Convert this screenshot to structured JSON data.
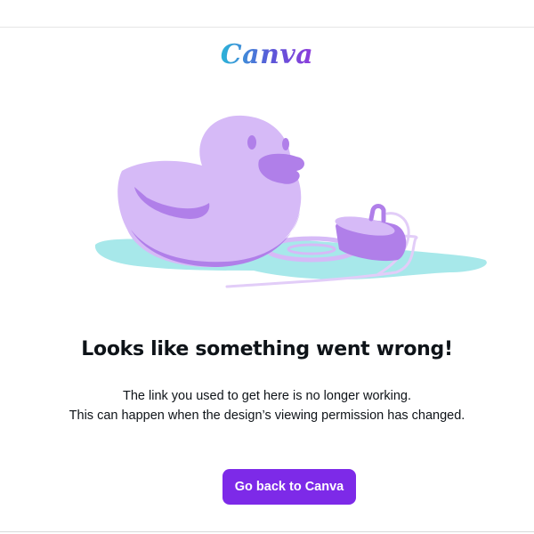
{
  "brand": {
    "name": "Canva"
  },
  "error": {
    "title": "Looks like something went wrong!",
    "description_line1": "The link you used to get here is no longer working.",
    "description_line2": "This can happen when the design’s viewing permission has changed."
  },
  "actions": {
    "go_back_label": "Go back to Canva"
  },
  "colors": {
    "accent": "#7d2ae8",
    "duck": "#d6baf7",
    "duck_shade": "#b07fe9",
    "puddle": "#a7e8ea"
  },
  "illustration": {
    "name": "rubber-duck-with-puddle"
  }
}
